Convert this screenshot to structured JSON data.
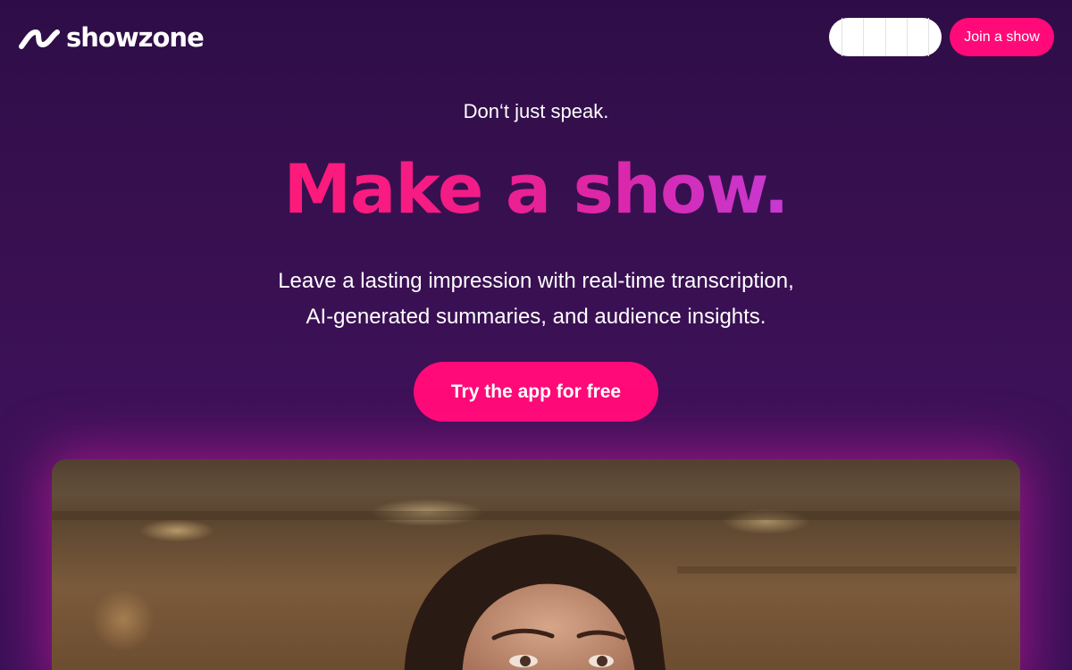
{
  "header": {
    "brand_name": "showzone",
    "join_button_label": "Join a show"
  },
  "hero": {
    "tagline": "Don‘t just speak.",
    "headline": "Make a show.",
    "description_line1": "Leave a lasting impression with real-time transcription,",
    "description_line2": "AI-generated summaries, and audience insights.",
    "cta_label": "Try the app for free"
  },
  "colors": {
    "background": "#2e0d47",
    "accent": "#ff0a78",
    "headline_gradient_start": "#ff1a7a",
    "headline_gradient_end": "#c63ad2"
  }
}
